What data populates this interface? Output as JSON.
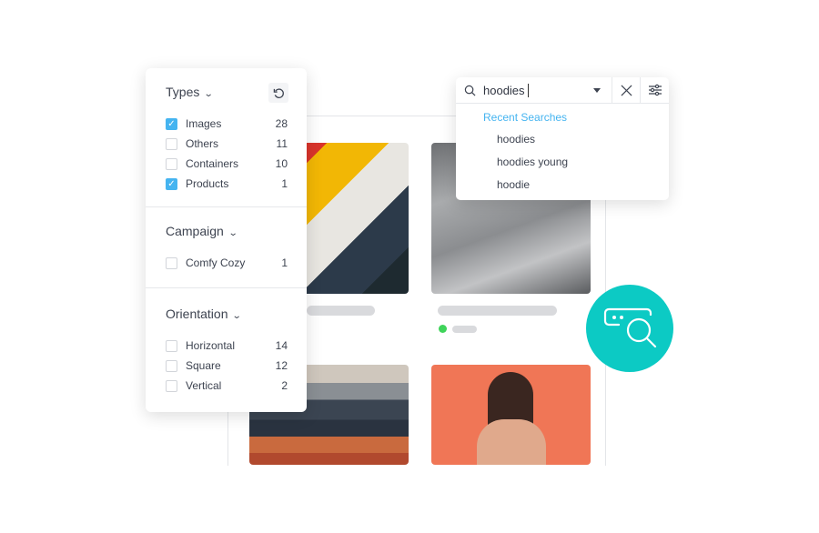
{
  "filters": {
    "types": {
      "title": "Types",
      "items": [
        {
          "label": "Images",
          "count": "28",
          "checked": true
        },
        {
          "label": "Others",
          "count": "11",
          "checked": false
        },
        {
          "label": "Containers",
          "count": "10",
          "checked": false
        },
        {
          "label": "Products",
          "count": "1",
          "checked": true
        }
      ]
    },
    "campaign": {
      "title": "Campaign",
      "items": [
        {
          "label": "Comfy Cozy",
          "count": "1",
          "checked": false
        }
      ]
    },
    "orientation": {
      "title": "Orientation",
      "items": [
        {
          "label": "Horizontal",
          "count": "14",
          "checked": false
        },
        {
          "label": "Square",
          "count": "12",
          "checked": false
        },
        {
          "label": "Vertical",
          "count": "2",
          "checked": false
        }
      ]
    }
  },
  "search": {
    "value": "hoodies",
    "recent_title": "Recent Searches",
    "recent": [
      "hoodies",
      "hoodies young",
      "hoodie"
    ]
  },
  "colors": {
    "accent": "#45b4f0",
    "teal": "#0ccac4",
    "status": "#3fd45a"
  }
}
